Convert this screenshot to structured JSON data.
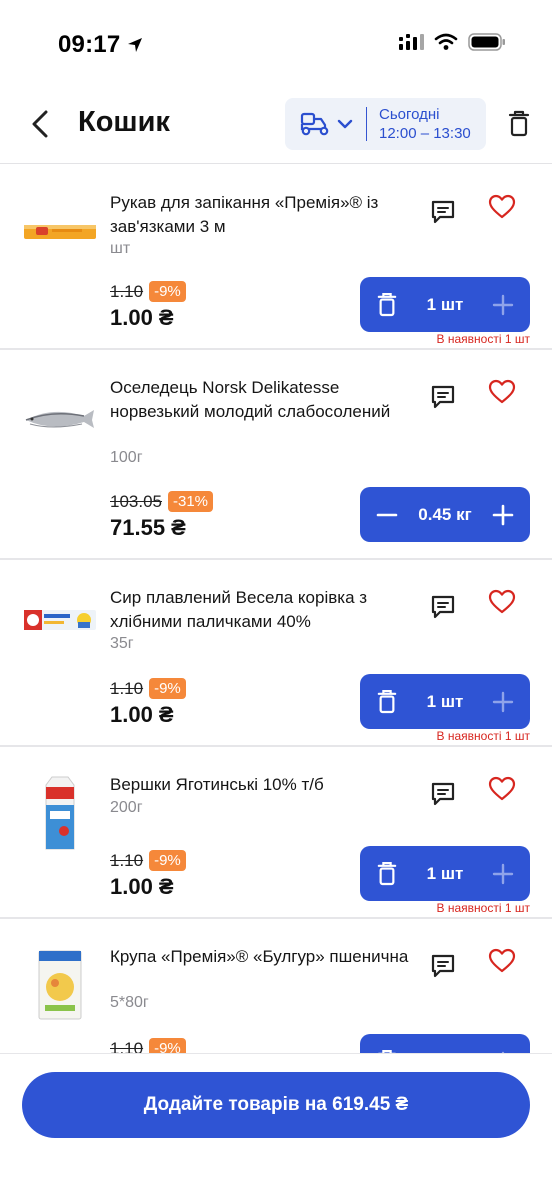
{
  "status_bar": {
    "time": "09:17"
  },
  "header": {
    "title": "Кошик",
    "delivery_day": "Сьогодні",
    "delivery_time": "12:00 – 13:30"
  },
  "items": [
    {
      "name": "Рукав для запікання «Премія»® із зав'язками 3 м",
      "unit": "шт",
      "old_price": "1.10",
      "discount": "-9%",
      "price": "1.00 ₴",
      "qty": "1 шт",
      "stock": "В наявності 1 шт"
    },
    {
      "name": "Оселедець Norsk Delikatesse норвезький молодий слабосолений",
      "unit": "100г",
      "old_price": "103.05",
      "discount": "-31%",
      "price": "71.55 ₴",
      "qty": "0.45 кг",
      "stock": ""
    },
    {
      "name": "Сир плавлений Весела корівка з хлібними паличками 40%",
      "unit": "35г",
      "old_price": "1.10",
      "discount": "-9%",
      "price": "1.00 ₴",
      "qty": "1 шт",
      "stock": "В наявності 1 шт"
    },
    {
      "name": "Вершки Яготинські 10% т/б",
      "unit": "200г",
      "old_price": "1.10",
      "discount": "-9%",
      "price": "1.00 ₴",
      "qty": "1 шт",
      "stock": "В наявності 1 шт"
    },
    {
      "name": "Крупа «Премія»® «Булгур» пшенична",
      "unit": "5*80г",
      "old_price": "1.10",
      "discount": "-9%",
      "price": "",
      "qty": "",
      "stock": ""
    }
  ],
  "checkout": {
    "label": "Додайте товарів на 619.45 ₴"
  },
  "colors": {
    "accent": "#2f54d4",
    "discount": "#f5883a",
    "favorite": "#d7261f",
    "stock": "#d7261f"
  },
  "icons": [
    "back-arrow-icon",
    "delivery-scooter-icon",
    "chevron-down-icon",
    "trash-icon",
    "comment-icon",
    "heart-icon",
    "minus-icon",
    "plus-icon",
    "location-arrow-icon",
    "signal-icon",
    "wifi-icon",
    "battery-icon"
  ]
}
